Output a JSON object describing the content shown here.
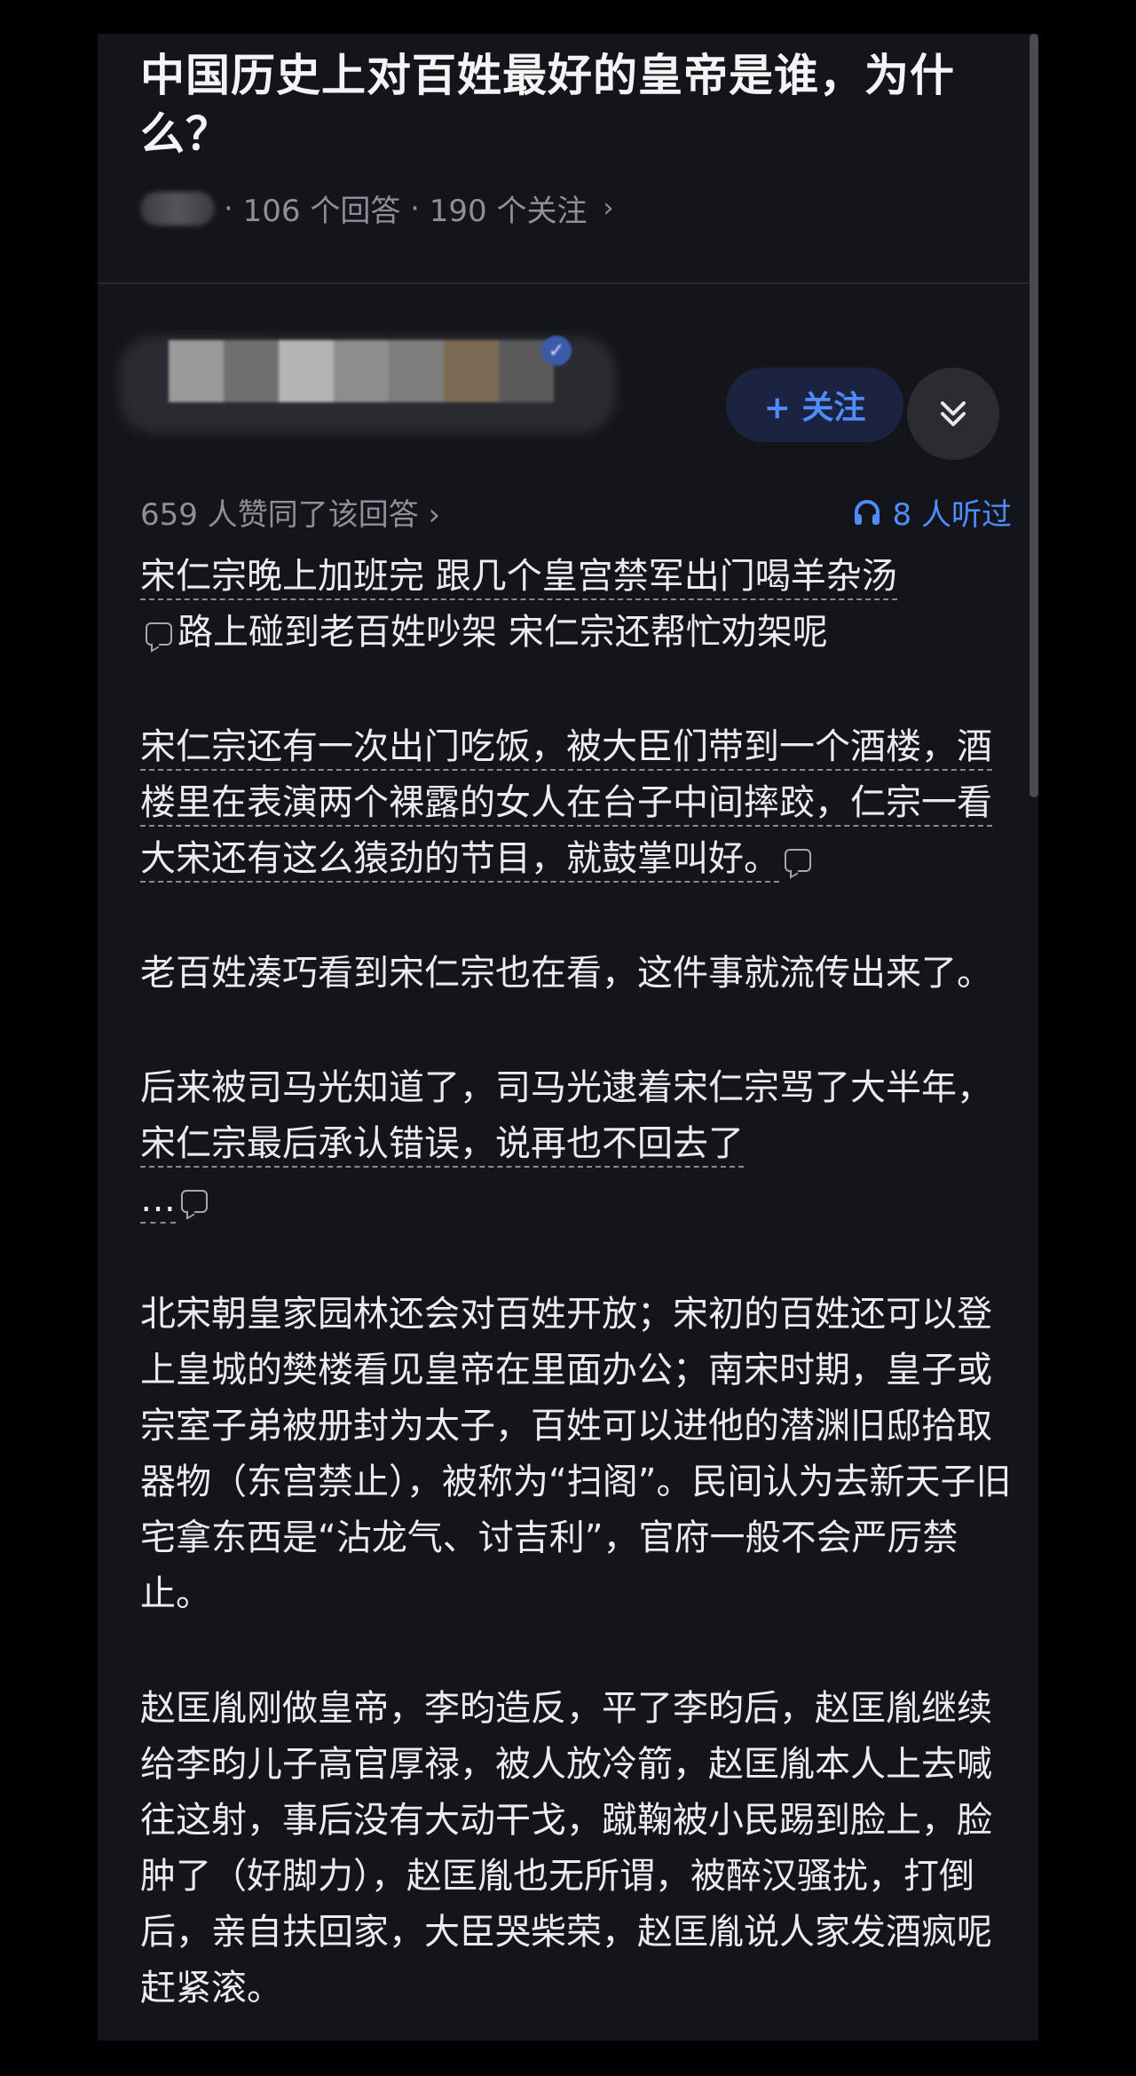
{
  "question": {
    "title": "中国历史上对百姓最好的皇帝是谁，为什么？",
    "answers_count": "106 个回答",
    "followers_count": "190 个关注",
    "separator": "·",
    "chevron_icon": "chevron-right-icon"
  },
  "author": {
    "follow_label": "+ 关注",
    "expand_icon": "double-chevron-down-icon"
  },
  "stats": {
    "likes": "659 人赞同了该回答 ›",
    "listened": "8 人听过",
    "listen_icon": "headphones-icon"
  },
  "answer": {
    "p1_a": "宋仁宗晚上加班完 跟几个皇宫禁军出门喝羊杂汤",
    "p1_b": "路上碰到老百姓吵架 宋仁宗还帮忙劝架呢",
    "p2": "宋仁宗还有一次出门吃饭，被大臣们带到一个酒楼，酒楼里在表演两个裸露的女人在台子中间摔跤，仁宗一看大宋还有这么猿劲的节目，就鼓掌叫好。",
    "p3": "老百姓凑巧看到宋仁宗也在看，这件事就流传出来了。",
    "p4_a": "后来被司马光知道了，司马光逮着宋仁宗骂了大半年，",
    "p4_b": "宋仁宗最后承认错误，说再也不回去了",
    "p4_c": "…",
    "p5": "北宋朝皇家园林还会对百姓开放；宋初的百姓还可以登上皇城的樊楼看见皇帝在里面办公；南宋时期，皇子或宗室子弟被册封为太子，百姓可以进他的潜渊旧邸拾取器物（东宫禁止），被称为“扫阁”。民间认为去新天子旧宅拿东西是“沾龙气、讨吉利”，官府一般不会严厉禁止。",
    "p6": "赵匡胤刚做皇帝，李昀造反，平了李昀后，赵匡胤继续给李昀儿子高官厚禄，被人放冷箭，赵匡胤本人上去喊往这射，事后没有大动干戈，蹴鞠被小民踢到脸上，脸肿了（好脚力），赵匡胤也无所谓，被醉汉骚扰，打倒后，亲自扶回家，大臣哭柴荣，赵匡胤说人家发酒疯呢赶紧滚。"
  },
  "colors": {
    "background": "#14151a",
    "accent_blue": "#4f8cff",
    "text": "#ececef",
    "muted": "#8f9097"
  }
}
